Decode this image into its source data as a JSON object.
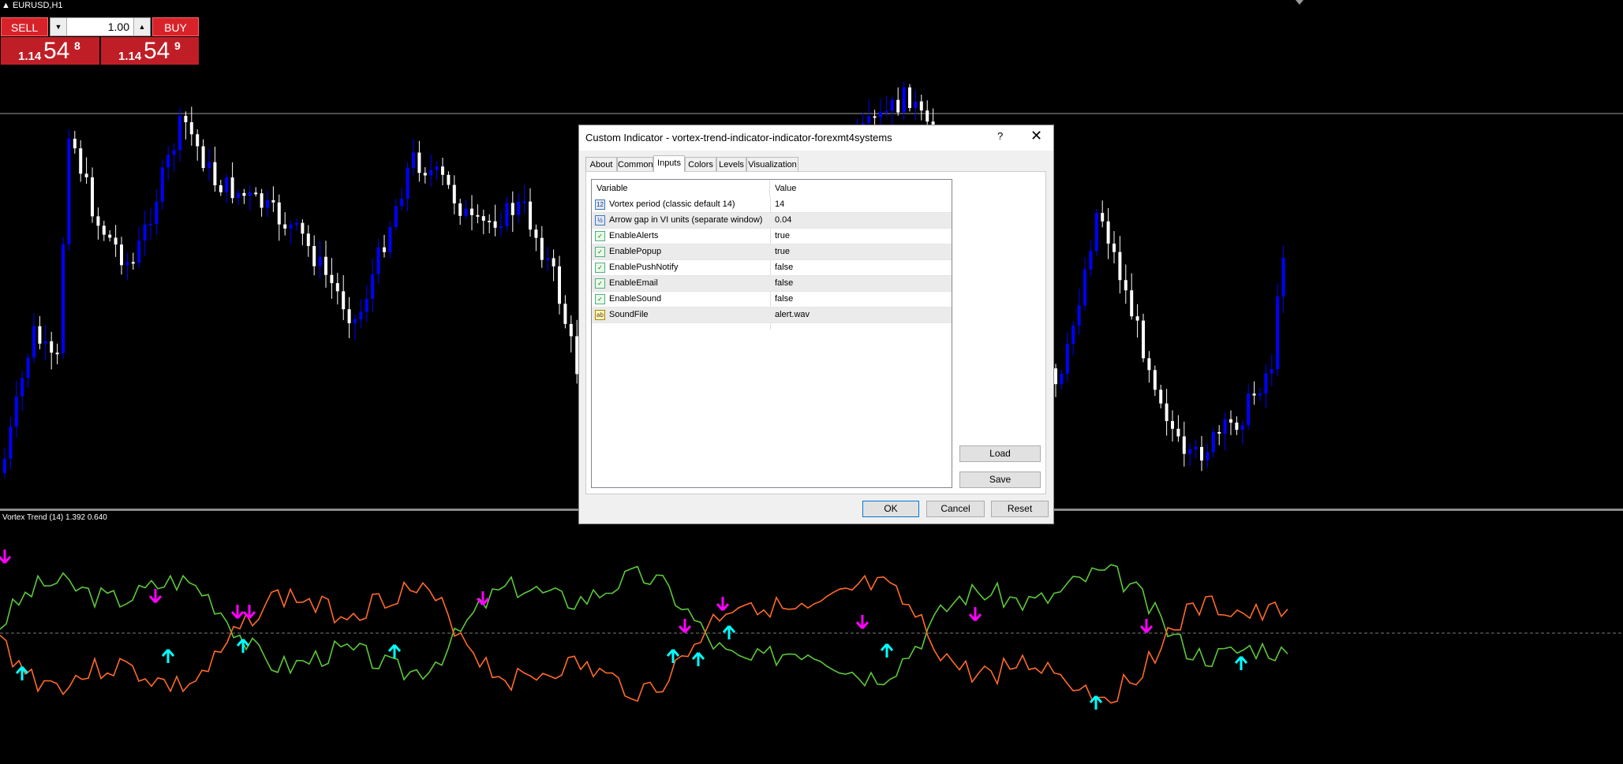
{
  "chart": {
    "symbol": "EURUSD,H1",
    "sell_label": "SELL",
    "buy_label": "BUY",
    "lot": "1.00",
    "sell_small": "1.14",
    "sell_big": "54",
    "sell_pip": "8",
    "buy_small": "1.14",
    "buy_big": "54",
    "buy_pip": "9",
    "indicator_label": "Vortex Trend (14) 1.392 0.640",
    "colors": {
      "bull": "#0000ff",
      "bear": "#ffffff",
      "vi_plus": "#5cc83a",
      "vi_minus": "#ff6a2a",
      "up_arrow": "#00ffff",
      "down_arrow": "#ff00ff"
    }
  },
  "dialog": {
    "title": "Custom Indicator - vortex-trend-indicator-indicator-forexmt4systems",
    "help": "?",
    "close": "✕",
    "tabs": [
      "About",
      "Common",
      "Inputs",
      "Colors",
      "Levels",
      "Visualization"
    ],
    "active_tab": "Inputs",
    "columns": [
      "Variable",
      "Value"
    ],
    "rows": [
      {
        "icon": "int-icon",
        "name": "Vortex period (classic default 14)",
        "value": "14"
      },
      {
        "icon": "double-icon",
        "name": "Arrow gap in VI units (separate window)",
        "value": "0.04"
      },
      {
        "icon": "bool-icon",
        "name": "EnableAlerts",
        "value": "true"
      },
      {
        "icon": "bool-icon",
        "name": "EnablePopup",
        "value": "true"
      },
      {
        "icon": "bool-icon",
        "name": "EnablePushNotify",
        "value": "false"
      },
      {
        "icon": "bool-icon",
        "name": "EnableEmail",
        "value": "false"
      },
      {
        "icon": "bool-icon",
        "name": "EnableSound",
        "value": "false"
      },
      {
        "icon": "string-icon",
        "name": "SoundFile",
        "value": "alert.wav"
      }
    ],
    "load": "Load",
    "save": "Save",
    "ok": "OK",
    "cancel": "Cancel",
    "reset": "Reset"
  }
}
